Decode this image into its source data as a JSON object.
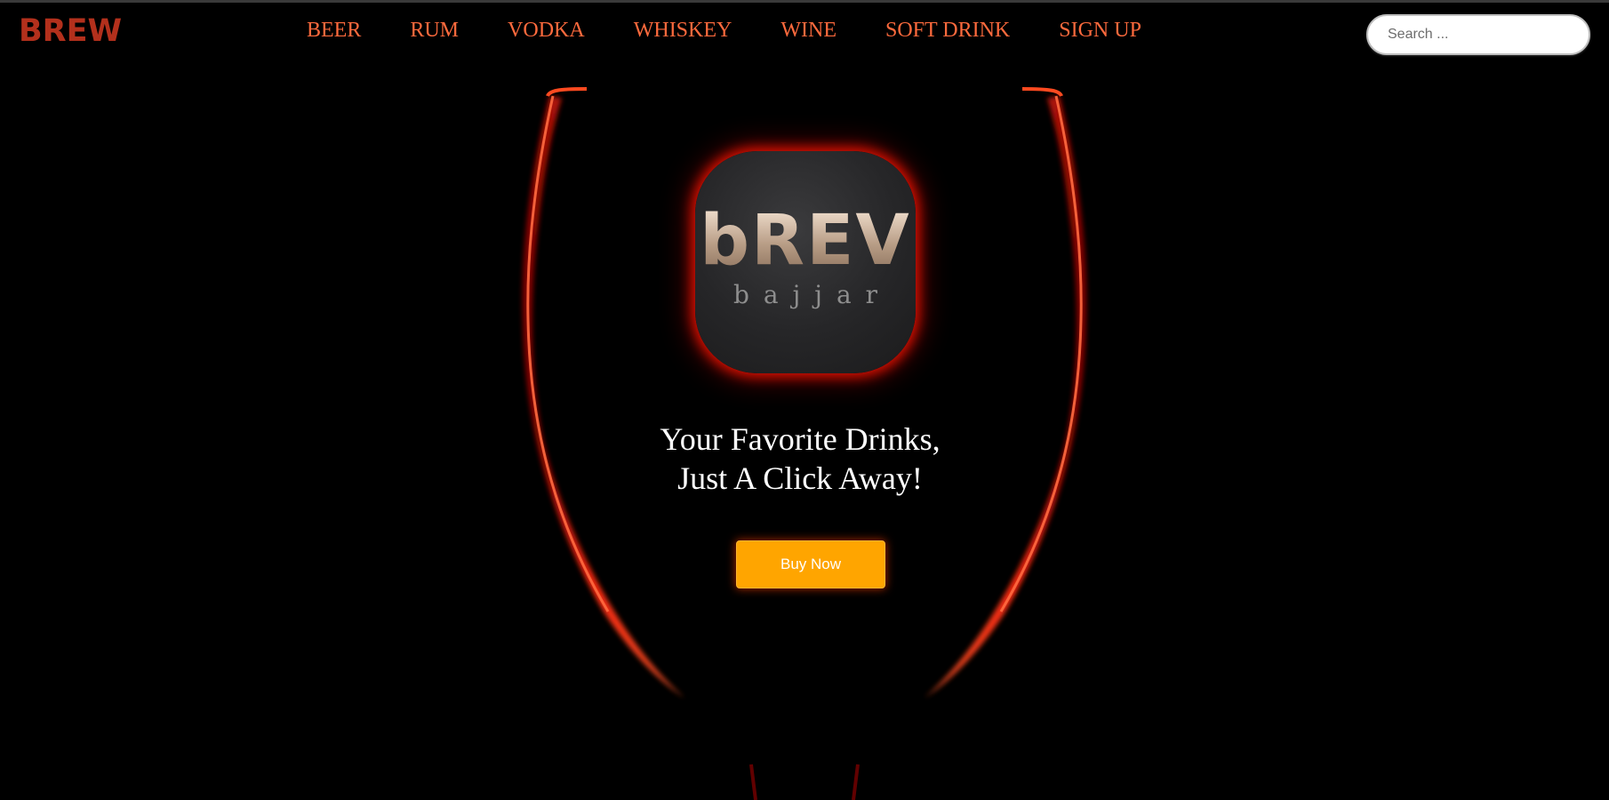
{
  "header": {
    "brand": "BREW",
    "nav": [
      "BEER",
      "RUM",
      "VODKA",
      "WHISKEY",
      "WINE",
      "SOFT DRINK",
      "SIGN UP"
    ],
    "search": {
      "placeholder": "Search ...",
      "value": ""
    }
  },
  "hero": {
    "logo": {
      "word": "bREV",
      "sub": "bajjar"
    },
    "tagline_line1": "Your Favorite Drinks,",
    "tagline_line2": "Just A Click Away!",
    "cta": "Buy Now"
  },
  "colors": {
    "brand": "#b3301c",
    "nav": "#ff6a3d",
    "cta": "#ffa500",
    "glass": "#ff2a10",
    "background": "#000000"
  }
}
